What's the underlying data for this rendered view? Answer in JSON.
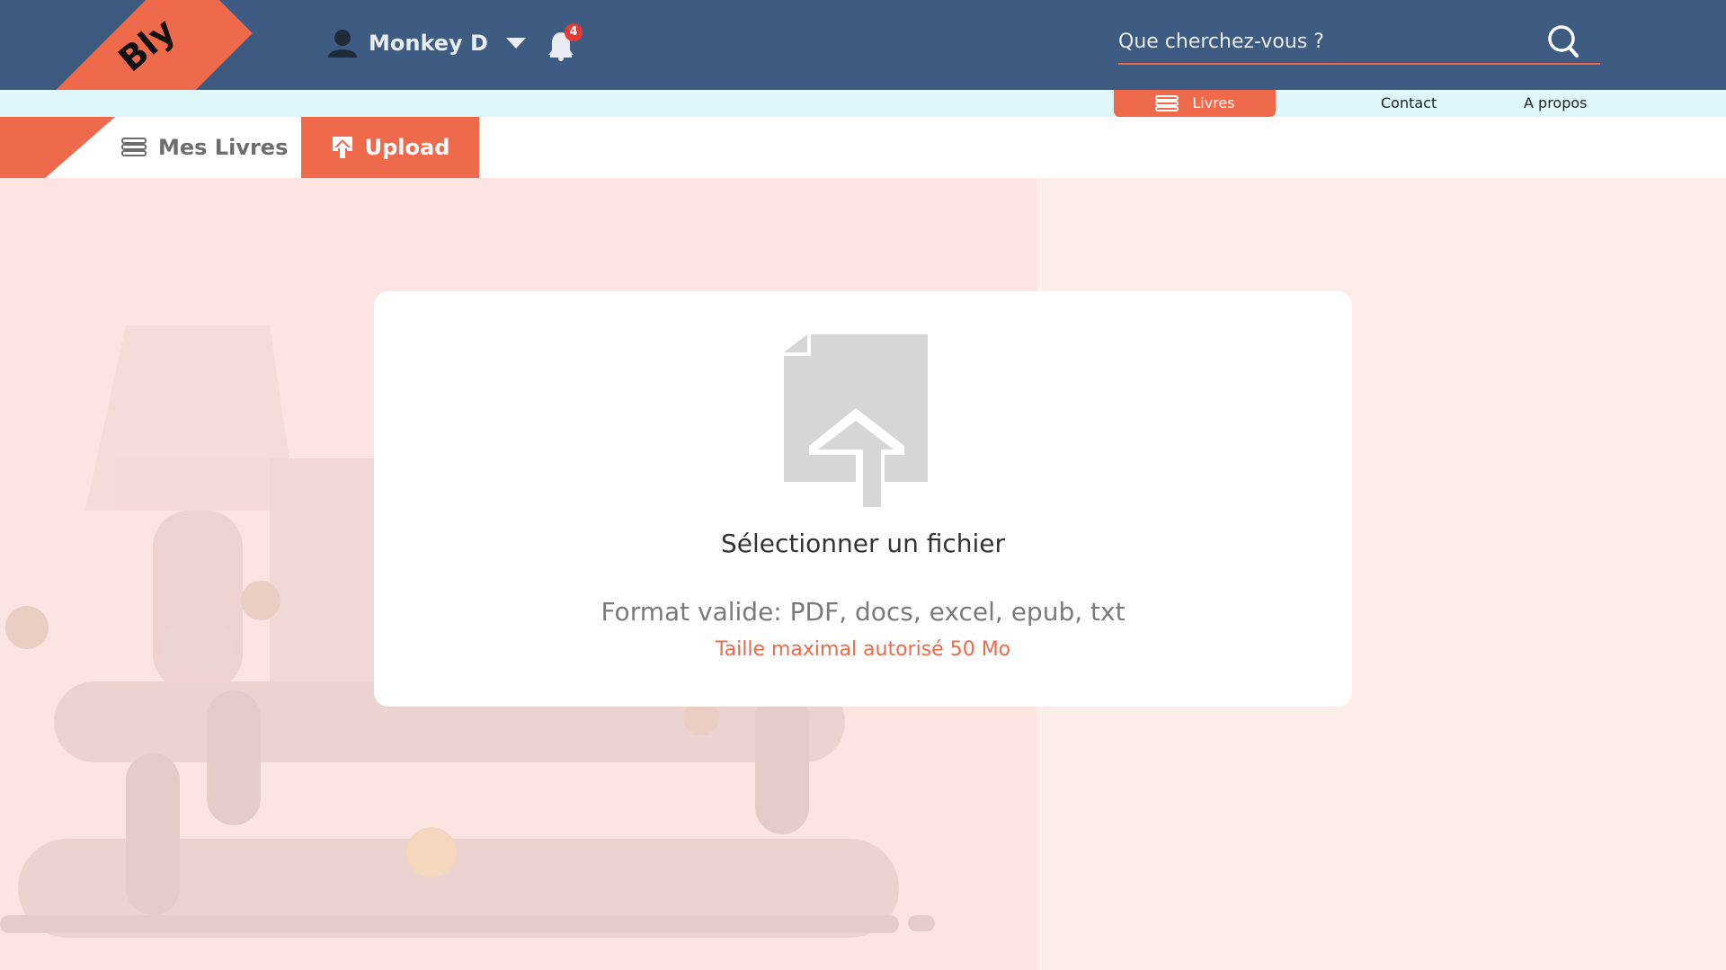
{
  "brand": {
    "logo": "Bly"
  },
  "colors": {
    "header": "#3e5b82",
    "accent": "#ef6a4a",
    "subnav": "#dff7f9",
    "page": "#fcedea"
  },
  "header": {
    "user_name": "Monkey D",
    "user_icon": "user-icon",
    "notifications_icon": "bell-icon",
    "notifications_count": "4",
    "search_placeholder": "Que cherchez-vous ?",
    "search_icon": "search-icon"
  },
  "subnav": {
    "items": [
      {
        "label": "Livres",
        "icon": "books-icon",
        "active": true
      },
      {
        "label": "Contact"
      },
      {
        "label": "A propos"
      }
    ]
  },
  "tabs": [
    {
      "label": "Mes Livres",
      "icon": "books-icon",
      "active": false
    },
    {
      "label": "Upload",
      "icon": "upload-icon",
      "active": true
    }
  ],
  "upload_card": {
    "icon": "file-upload-icon",
    "select_label": "Sélectionner un fichier",
    "formats": "Format valide: PDF, docs, excel, epub, txt",
    "max_size": "Taille maximal autorisé 50 Mo"
  }
}
